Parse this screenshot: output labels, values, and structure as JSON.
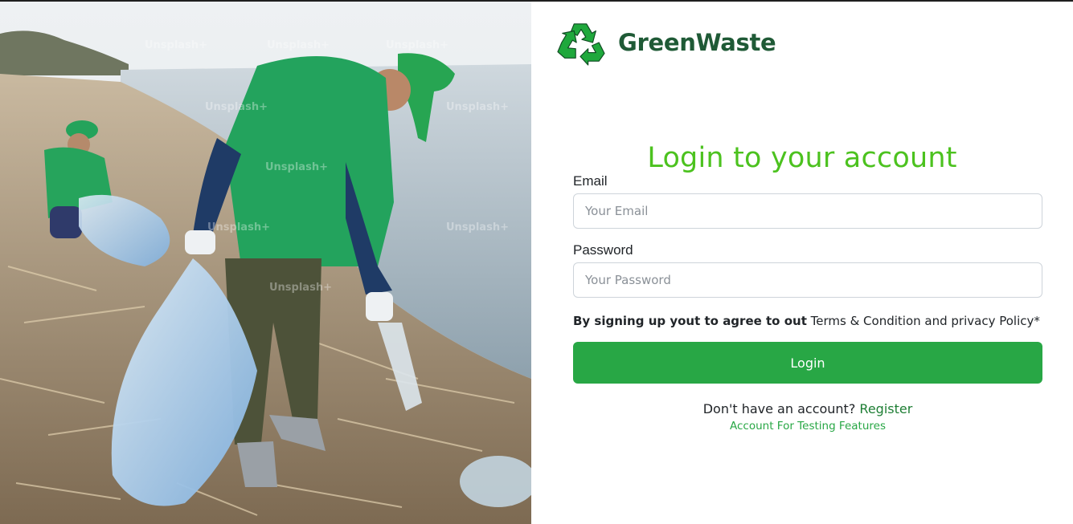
{
  "brand": {
    "name": "GreenWaste",
    "logo_icon": "recycle-icon",
    "name_color": "#1f5a36",
    "logo_color": "#1fa83c"
  },
  "photo": {
    "watermark_text": "Unsplash+"
  },
  "login": {
    "title": "Login to your account",
    "title_color": "#4cc21f",
    "email_label": "Email",
    "email_placeholder": "Your Email",
    "email_value": "",
    "password_label": "Password",
    "password_placeholder": "Your Password",
    "password_value": "",
    "terms_bold": "By signing up yout to agree to out",
    "terms_rest": "Terms & Condition and privacy Policy*",
    "button_label": "Login",
    "button_color": "#28a745",
    "no_account_text": "Don't have an account?",
    "register_label": "Register",
    "testing_label": "Account For Testing Features"
  }
}
